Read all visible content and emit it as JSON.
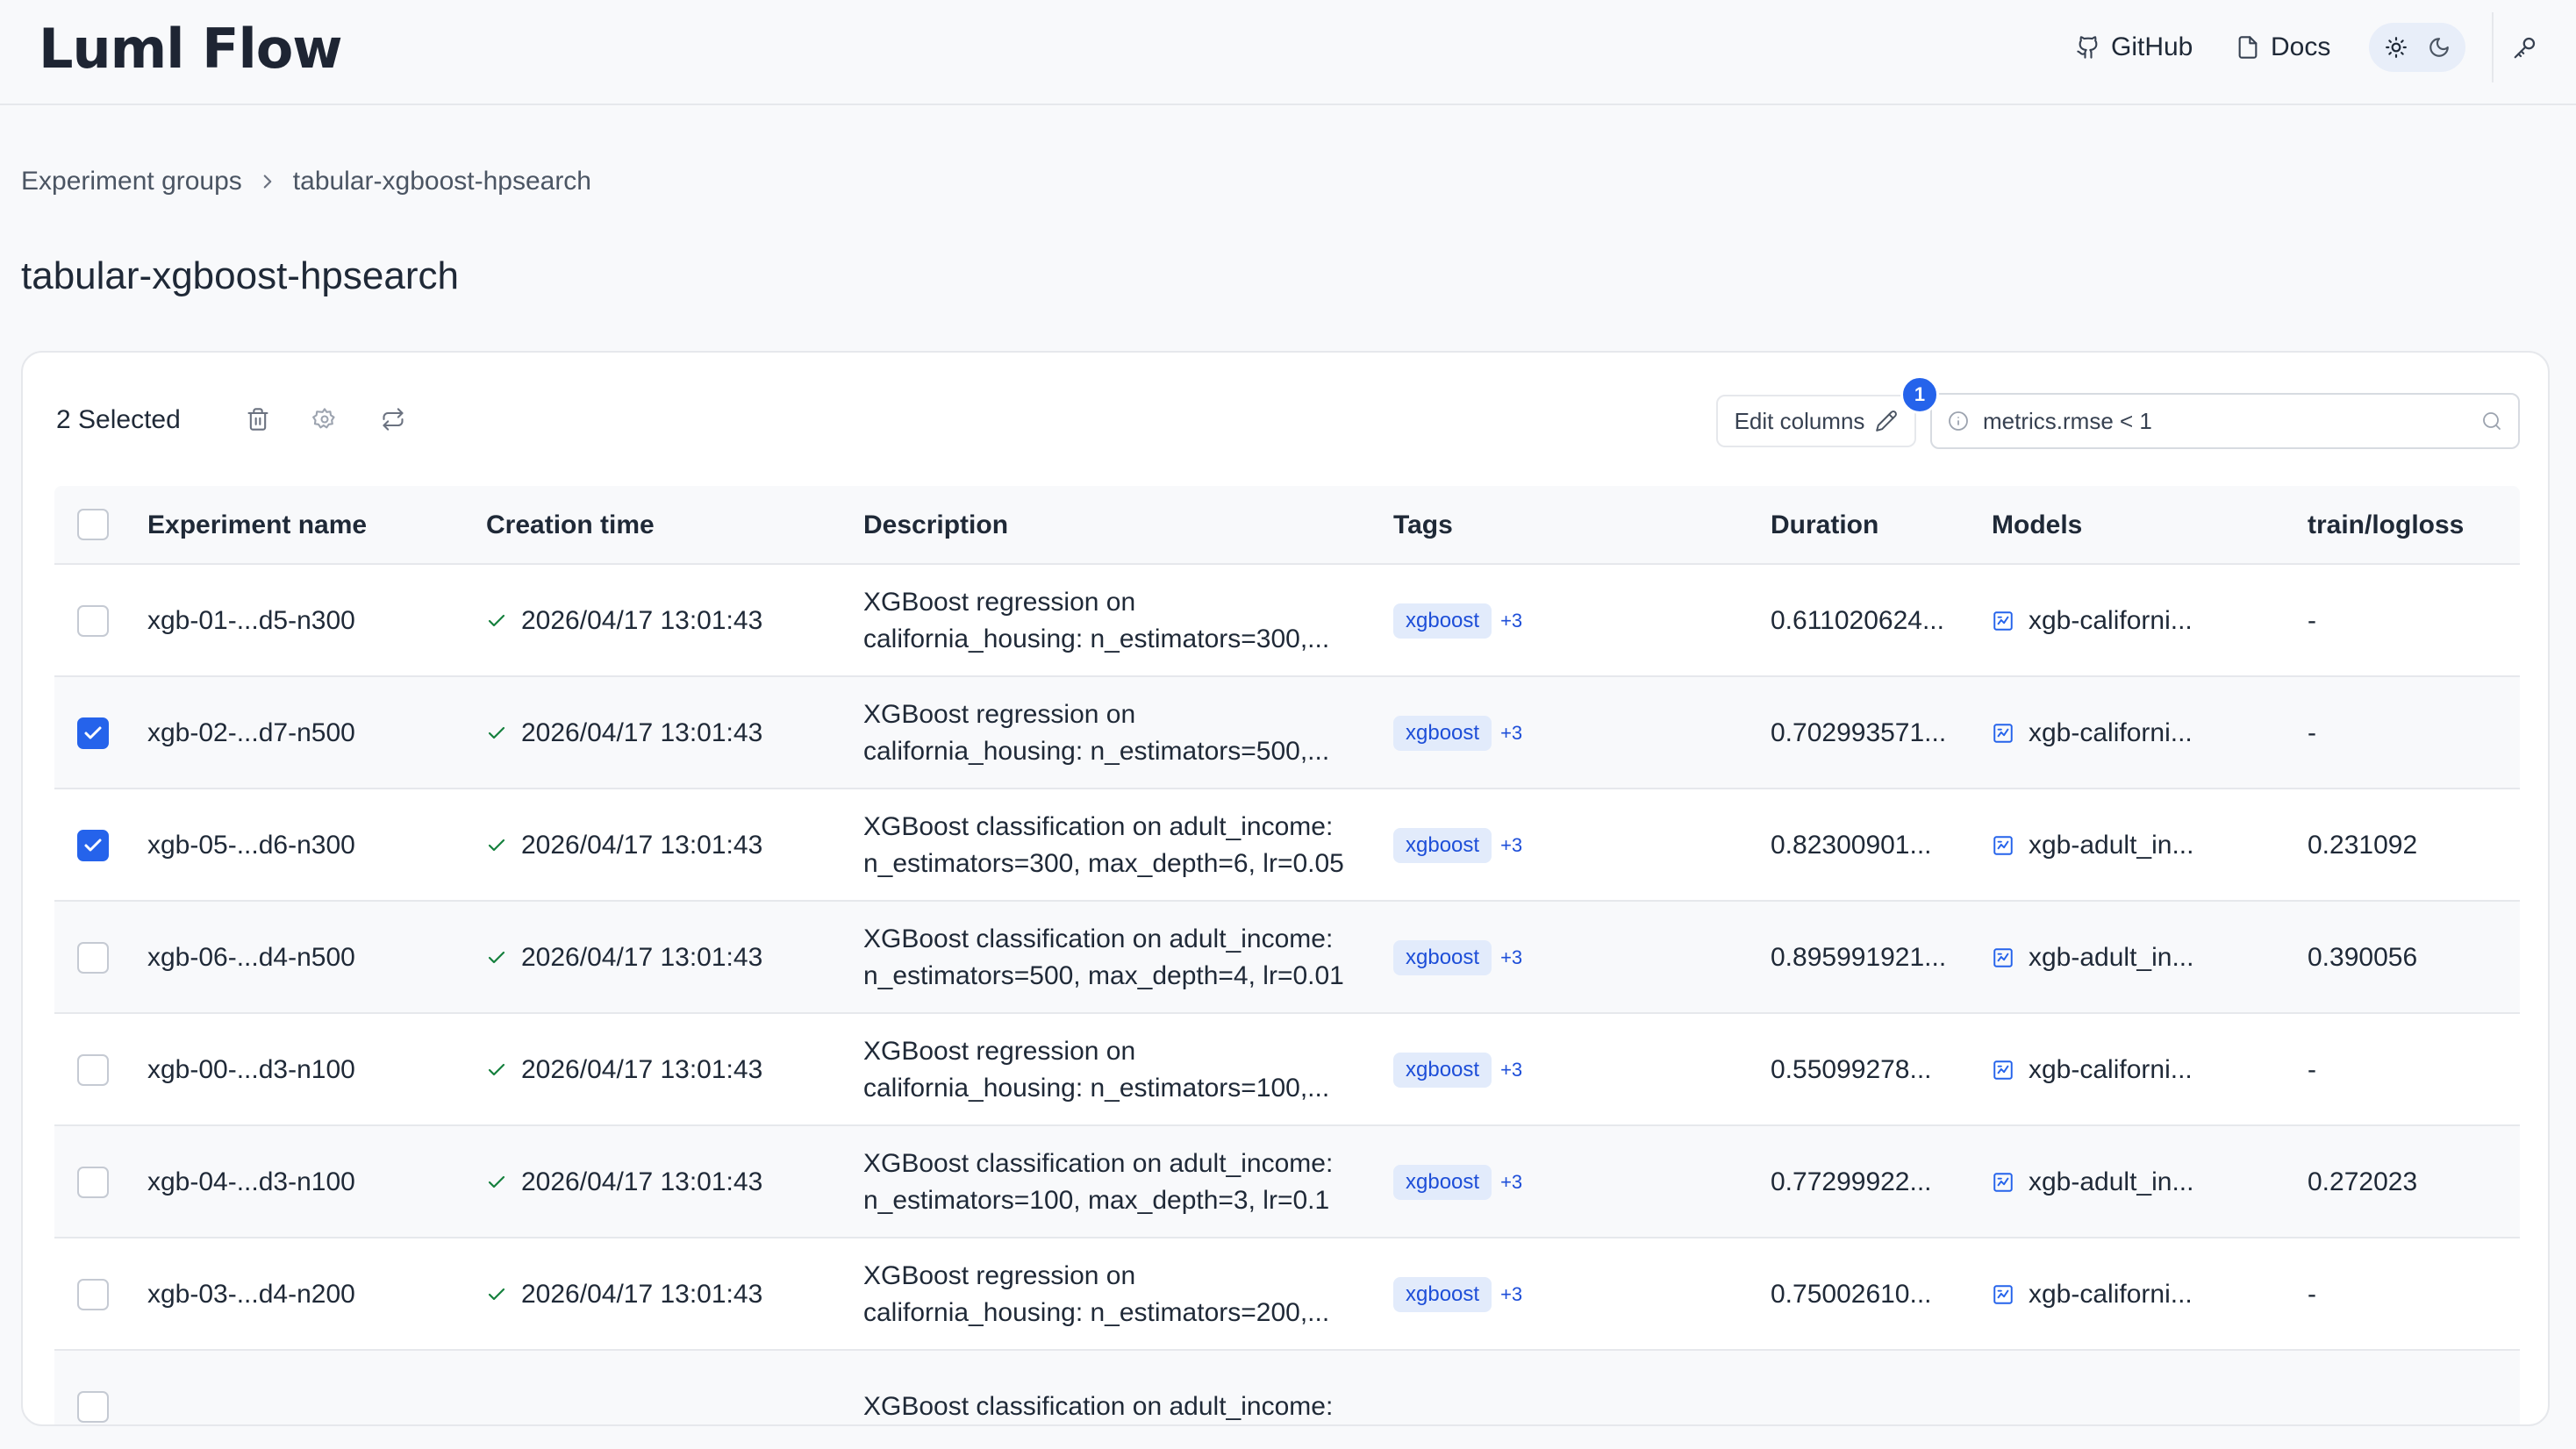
{
  "app": {
    "logo": "Luml Flow"
  },
  "header": {
    "github_label": "GitHub",
    "docs_label": "Docs"
  },
  "breadcrumb": {
    "root": "Experiment groups",
    "current": "tabular-xgboost-hpsearch"
  },
  "page": {
    "title": "tabular-xgboost-hpsearch"
  },
  "toolbar": {
    "selected_label": "2 Selected",
    "edit_columns_label": "Edit columns",
    "filter_badge": "1",
    "search_value": "metrics.rmse < 1"
  },
  "table": {
    "headers": {
      "name": "Experiment name",
      "created": "Creation time",
      "description": "Description",
      "tags": "Tags",
      "duration": "Duration",
      "models": "Models",
      "metric": "train/logloss"
    },
    "rows": [
      {
        "checked": false,
        "name": "xgb-01-...d5-n300",
        "created": "2026/04/17 13:01:43",
        "desc1": "XGBoost regression on",
        "desc2": "california_housing: n_estimators=300,...",
        "tag": "xgboost",
        "more": "+3",
        "duration": "0.611020624...",
        "model": "xgb-californi...",
        "metric": "-"
      },
      {
        "checked": true,
        "name": "xgb-02-...d7-n500",
        "created": "2026/04/17 13:01:43",
        "desc1": "XGBoost regression on",
        "desc2": "california_housing: n_estimators=500,...",
        "tag": "xgboost",
        "more": "+3",
        "duration": "0.702993571...",
        "model": "xgb-californi...",
        "metric": "-"
      },
      {
        "checked": true,
        "name": "xgb-05-...d6-n300",
        "created": "2026/04/17 13:01:43",
        "desc1": "XGBoost classification on adult_income:",
        "desc2": "n_estimators=300, max_depth=6, lr=0.05",
        "tag": "xgboost",
        "more": "+3",
        "duration": "0.82300901...",
        "model": "xgb-adult_in...",
        "metric": "0.231092"
      },
      {
        "checked": false,
        "name": "xgb-06-...d4-n500",
        "created": "2026/04/17 13:01:43",
        "desc1": "XGBoost classification on adult_income:",
        "desc2": "n_estimators=500, max_depth=4, lr=0.01",
        "tag": "xgboost",
        "more": "+3",
        "duration": "0.895991921...",
        "model": "xgb-adult_in...",
        "metric": "0.390056"
      },
      {
        "checked": false,
        "name": "xgb-00-...d3-n100",
        "created": "2026/04/17 13:01:43",
        "desc1": "XGBoost regression on",
        "desc2": "california_housing: n_estimators=100,...",
        "tag": "xgboost",
        "more": "+3",
        "duration": "0.55099278...",
        "model": "xgb-californi...",
        "metric": "-"
      },
      {
        "checked": false,
        "name": "xgb-04-...d3-n100",
        "created": "2026/04/17 13:01:43",
        "desc1": "XGBoost classification on adult_income:",
        "desc2": "n_estimators=100, max_depth=3, lr=0.1",
        "tag": "xgboost",
        "more": "+3",
        "duration": "0.77299922...",
        "model": "xgb-adult_in...",
        "metric": "0.272023"
      },
      {
        "checked": false,
        "name": "xgb-03-...d4-n200",
        "created": "2026/04/17 13:01:43",
        "desc1": "XGBoost regression on",
        "desc2": "california_housing: n_estimators=200,...",
        "tag": "xgboost",
        "more": "+3",
        "duration": "0.75002610...",
        "model": "xgb-californi...",
        "metric": "-"
      },
      {
        "checked": false,
        "name": "",
        "created": "",
        "desc1": "XGBoost classification on adult_income:",
        "desc2": "",
        "tag": "",
        "more": "",
        "duration": "",
        "model": "",
        "metric": ""
      }
    ]
  },
  "colors": {
    "accent": "#2563eb",
    "tag_bg": "#e2ebfb",
    "success": "#15803d"
  }
}
